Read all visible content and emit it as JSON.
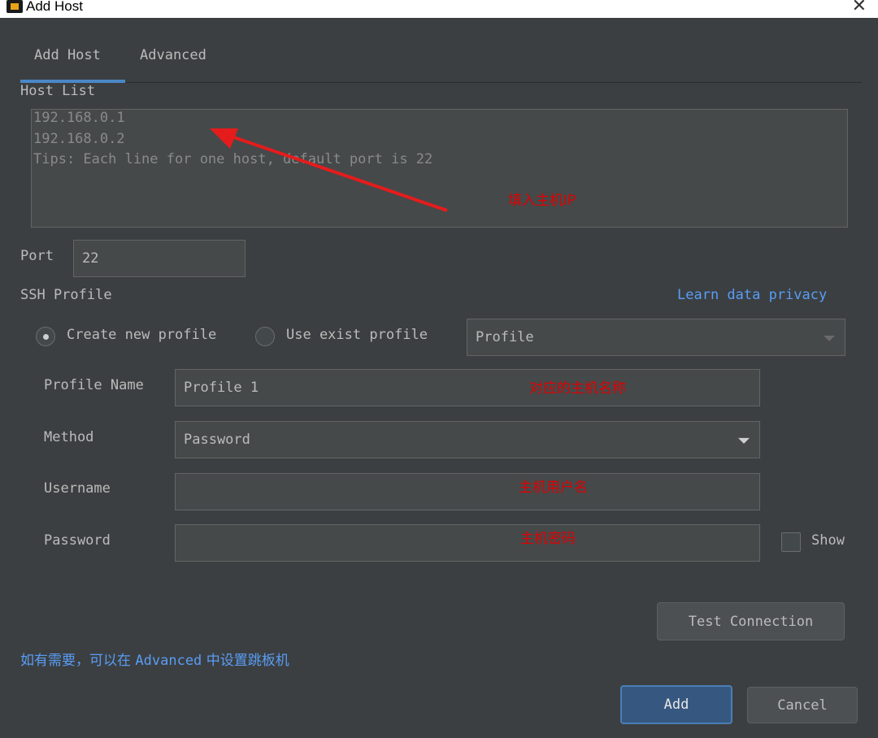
{
  "window": {
    "title": "Add Host",
    "close_glyph": "✕"
  },
  "tabs": [
    {
      "label": "Add Host",
      "active": true
    },
    {
      "label": "Advanced",
      "active": false
    }
  ],
  "host_list": {
    "label": "Host List",
    "lines": [
      "192.168.0.1",
      "192.168.0.2",
      "Tips: Each line for one host, default port is 22"
    ],
    "annotation": "填入主机IP"
  },
  "port": {
    "label": "Port",
    "value": "22"
  },
  "ssh_profile": {
    "label": "SSH Profile",
    "privacy_link": "Learn data privacy",
    "create_new": "Create new profile",
    "use_exist": "Use exist profile",
    "profile_select": "Profile"
  },
  "profile_name": {
    "label": "Profile Name",
    "value": "Profile 1",
    "annotation": "对应的主机名称"
  },
  "method": {
    "label": "Method",
    "value": "Password"
  },
  "username": {
    "label": "Username",
    "value": "",
    "annotation": "主机用户名"
  },
  "password": {
    "label": "Password",
    "value": "",
    "annotation": "主机密码",
    "show_label": "Show"
  },
  "test_connection": "Test Connection",
  "tip": {
    "before": "如有需要，可以在 ",
    "keyword": "Advanced",
    "after": " 中设置跳板机"
  },
  "buttons": {
    "add": "Add",
    "cancel": "Cancel"
  },
  "colors": {
    "accent": "#4a88c7",
    "link": "#589df6",
    "annotation": "#e00000",
    "background": "#3c3f41"
  }
}
